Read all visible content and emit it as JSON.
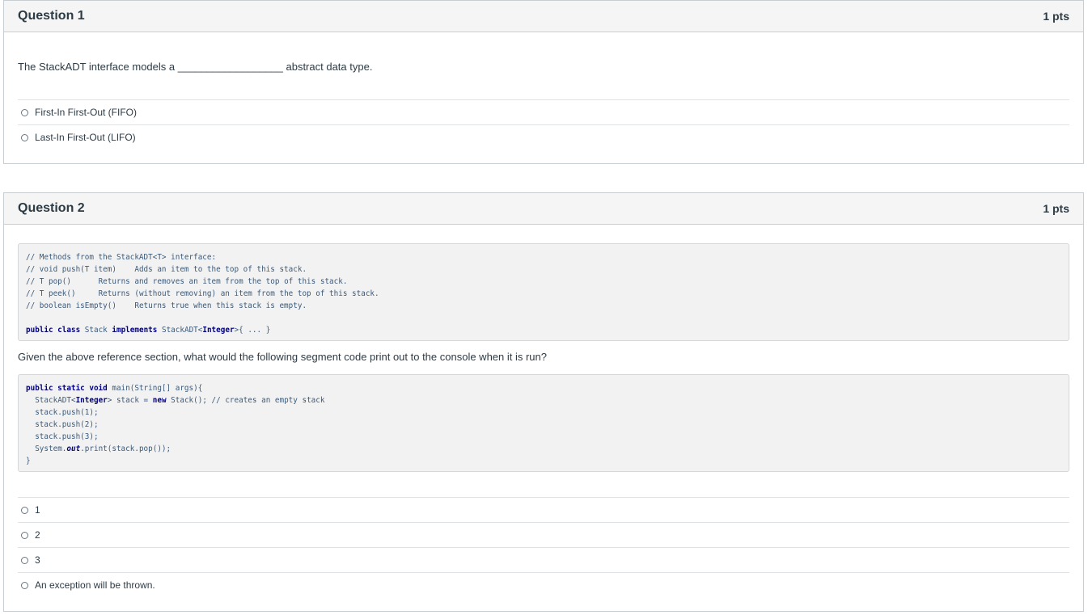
{
  "q1": {
    "title": "Question 1",
    "points": "1 pts",
    "text": "The StackADT interface models a __________________ abstract data type.",
    "answers": [
      "First-In First-Out (FIFO)",
      "Last-In First-Out (LIFO)"
    ]
  },
  "q2": {
    "title": "Question 2",
    "points": "1 pts",
    "reference": {
      "c1": "// Methods from the StackADT<T> interface:",
      "c2a": "// void push(T item)",
      "c2b": "Adds an item to the top of this stack.",
      "c3a": "// T pop()",
      "c3b": "Returns and removes an item from the top of this stack.",
      "c4a": "// T peek()",
      "c4b": "Returns (without removing) an item from the top of this stack.",
      "c5a": "// boolean isEmpty()",
      "c5b": "Returns true when this stack is empty.",
      "kw_public_class": "public class",
      "cls": "Stack",
      "kw_implements": "implements",
      "iface": "StackADT<",
      "iface_type": "Integer",
      "iface_end": ">{ ... }"
    },
    "prompt": "Given the above reference section, what would the following segment code print out to the console when it is run?",
    "code": {
      "kw_main": "public static void",
      "main_sig": "main(String[] args){",
      "decl_a": "StackADT<",
      "decl_type": "Integer",
      "decl_b": "> stack = ",
      "kw_new": "new",
      "decl_c": "Stack(); ",
      "decl_comment": "// creates an empty stack",
      "push1": "stack.push(1);",
      "push2": "stack.push(2);",
      "push3": "stack.push(3);",
      "print_a": "System.",
      "print_out": "out",
      "print_b": ".print(stack.pop());",
      "close": "}"
    },
    "answers": [
      "1",
      "2",
      "3",
      "An exception will be thrown."
    ]
  }
}
